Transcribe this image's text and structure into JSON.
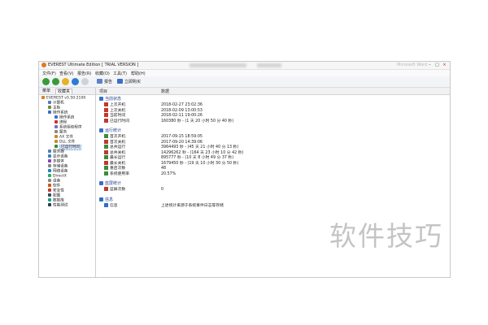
{
  "window": {
    "title": "EVEREST Ultimate Edition [ TRIAL VERSION ]",
    "blurred_title_suffix": "Microsoft Word"
  },
  "menu": [
    "文件(F)",
    "查看(V)",
    "报告(R)",
    "收藏(O)",
    "工具(T)",
    "帮助(H)"
  ],
  "toolbar": {
    "report_label": "报告",
    "updates_label": "立即购买"
  },
  "left_panel": {
    "tabs": [
      "菜单",
      "收藏夹"
    ],
    "tree": [
      {
        "label": "EVEREST v5.50.2100",
        "indent": 0,
        "color": "#e07a1f"
      },
      {
        "label": "计算机",
        "indent": 1,
        "color": "#5a7ab8"
      },
      {
        "label": "主板",
        "indent": 1,
        "color": "#6b8e3a"
      },
      {
        "label": "操作系统",
        "indent": 1,
        "color": "#3a6fc9"
      },
      {
        "label": "操作系统",
        "indent": 2,
        "color": "#3a6fc9"
      },
      {
        "label": "进程",
        "indent": 2,
        "color": "#c0392b"
      },
      {
        "label": "系统驱动程序",
        "indent": 2,
        "color": "#7b6fb0"
      },
      {
        "label": "服务",
        "indent": 2,
        "color": "#8a8a8a"
      },
      {
        "label": "AX 文件",
        "indent": 2,
        "color": "#c98a2b"
      },
      {
        "label": "DLL 文件",
        "indent": 2,
        "color": "#c98a2b"
      },
      {
        "label": "已运行时间",
        "indent": 2,
        "color": "#3a8c3a",
        "selected": true
      },
      {
        "label": "服务器",
        "indent": 1,
        "color": "#5a7ab8"
      },
      {
        "label": "显示设备",
        "indent": 1,
        "color": "#2e86c1"
      },
      {
        "label": "多媒体",
        "indent": 1,
        "color": "#8e44ad"
      },
      {
        "label": "存储设备",
        "indent": 1,
        "color": "#7f8c8d"
      },
      {
        "label": "网络设备",
        "indent": 1,
        "color": "#2980b9"
      },
      {
        "label": "DirectX",
        "indent": 1,
        "color": "#27ae60"
      },
      {
        "label": "设备",
        "indent": 1,
        "color": "#7f8c8d"
      },
      {
        "label": "软件",
        "indent": 1,
        "color": "#d35400"
      },
      {
        "label": "安全性",
        "indent": 1,
        "color": "#c0392b"
      },
      {
        "label": "配置",
        "indent": 1,
        "color": "#34495e"
      },
      {
        "label": "数据库",
        "indent": 1,
        "color": "#16a085"
      },
      {
        "label": "性能测试",
        "indent": 1,
        "color": "#2c3e50"
      }
    ]
  },
  "content": {
    "headers": [
      "项目",
      "数据"
    ],
    "sections": [
      {
        "title": "当前状态",
        "color": "#3a6fc9",
        "rows": [
          {
            "name": "上次开机",
            "value": "2018-02-27 23:02:36",
            "color": "#c0392b"
          },
          {
            "name": "上次关机",
            "value": "2018-02-09 13:00:53",
            "color": "#c0392b"
          },
          {
            "name": "当前时间",
            "value": "2018-02-11 19:00:26",
            "color": "#c0392b"
          },
          {
            "name": "已运行时间",
            "value": "160380 秒 - (1 天 20 小时 50 分 40 秒)",
            "color": "#c0392b"
          }
        ]
      },
      {
        "title": "运行统计",
        "color": "#3a6fc9",
        "rows": [
          {
            "name": "首次开机",
            "value": "2017-09-15 18:59:05",
            "color": "#3a8c3a"
          },
          {
            "name": "首次关机",
            "value": "2017-09-20 14:39:06",
            "color": "#c0392b"
          },
          {
            "name": "总共运行",
            "value": "3964493 秒 - (45 天 21 小时 40 分 13 秒)",
            "color": "#3a8c3a"
          },
          {
            "name": "总共关机",
            "value": "14296262 秒 - (164 天 23 小时 10 分 42 秒)",
            "color": "#c0392b"
          },
          {
            "name": "最长运行",
            "value": "895777 秒 - (10 天 8 小时 49 分 37 秒)",
            "color": "#3a8c3a"
          },
          {
            "name": "最长关机",
            "value": "1679450 秒 - (19 天 10 小时 30 分 50 秒)",
            "color": "#c0392b"
          },
          {
            "name": "重启次数",
            "value": "48",
            "color": "#3a8c3a"
          },
          {
            "name": "系统使用率",
            "value": "20.57%",
            "color": "#3a8c3a"
          }
        ]
      },
      {
        "title": "蓝屏统计",
        "color": "#3a6fc9",
        "rows": [
          {
            "name": "蓝屏次数",
            "value": "0",
            "color": "#c0392b"
          }
        ]
      },
      {
        "title": "信息",
        "color": "#2c6fc9",
        "rows": [
          {
            "name": "信息",
            "value": "上述统计来源于系统事件日志等存储",
            "color": "#2c6fc9"
          }
        ]
      }
    ]
  },
  "watermark": "软件技巧"
}
